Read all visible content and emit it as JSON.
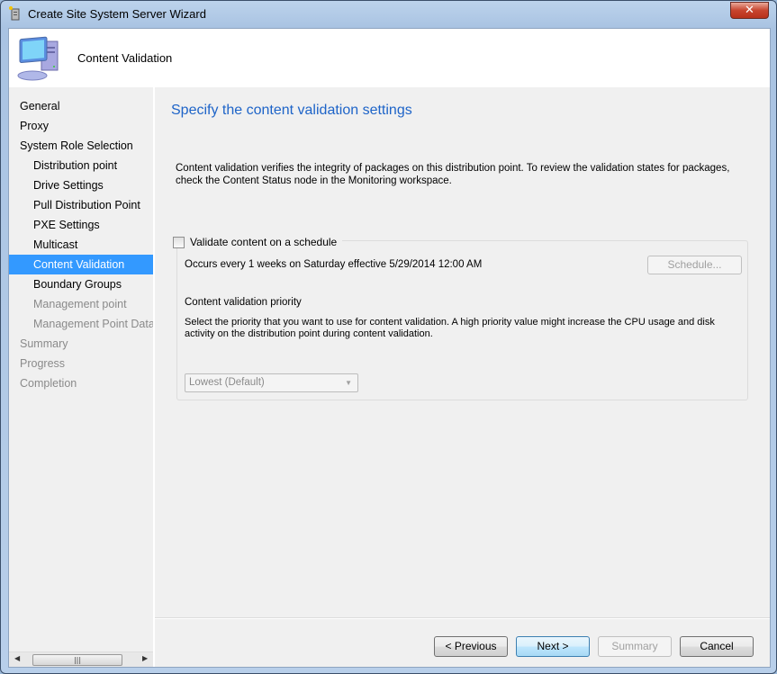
{
  "window": {
    "title": "Create Site System Server Wizard",
    "close_label": "✕"
  },
  "header": {
    "title": "Content Validation"
  },
  "nav": {
    "items": [
      {
        "label": "General",
        "level": 0,
        "state": "normal"
      },
      {
        "label": "Proxy",
        "level": 0,
        "state": "normal"
      },
      {
        "label": "System Role Selection",
        "level": 0,
        "state": "normal"
      },
      {
        "label": "Distribution point",
        "level": 1,
        "state": "normal"
      },
      {
        "label": "Drive Settings",
        "level": 1,
        "state": "normal"
      },
      {
        "label": "Pull Distribution Point",
        "level": 1,
        "state": "normal"
      },
      {
        "label": "PXE Settings",
        "level": 1,
        "state": "normal"
      },
      {
        "label": "Multicast",
        "level": 1,
        "state": "normal"
      },
      {
        "label": "Content Validation",
        "level": 1,
        "state": "selected"
      },
      {
        "label": "Boundary Groups",
        "level": 1,
        "state": "normal"
      },
      {
        "label": "Management point",
        "level": 1,
        "state": "disabled"
      },
      {
        "label": "Management Point Database",
        "level": 1,
        "state": "disabled"
      },
      {
        "label": "Summary",
        "level": 0,
        "state": "disabled"
      },
      {
        "label": "Progress",
        "level": 0,
        "state": "disabled"
      },
      {
        "label": "Completion",
        "level": 0,
        "state": "disabled"
      }
    ]
  },
  "main": {
    "heading": "Specify the content validation settings",
    "description": "Content validation verifies the integrity of packages on this distribution point. To review the validation states for packages, check the Content Status node in the Monitoring workspace.",
    "schedule_checkbox": {
      "label": "Validate content on a schedule",
      "checked": false
    },
    "occurs_text": "Occurs every 1 weeks on Saturday effective 5/29/2014 12:00 AM",
    "schedule_button": "Schedule...",
    "priority_label": "Content validation priority",
    "priority_help": "Select the priority that you want to use for content validation. A high priority value might increase the CPU usage and disk activity on the distribution point during content validation.",
    "priority_select": {
      "value": "Lowest (Default)"
    }
  },
  "buttons": {
    "previous": "< Previous",
    "next": "Next >",
    "summary": "Summary",
    "cancel": "Cancel"
  }
}
